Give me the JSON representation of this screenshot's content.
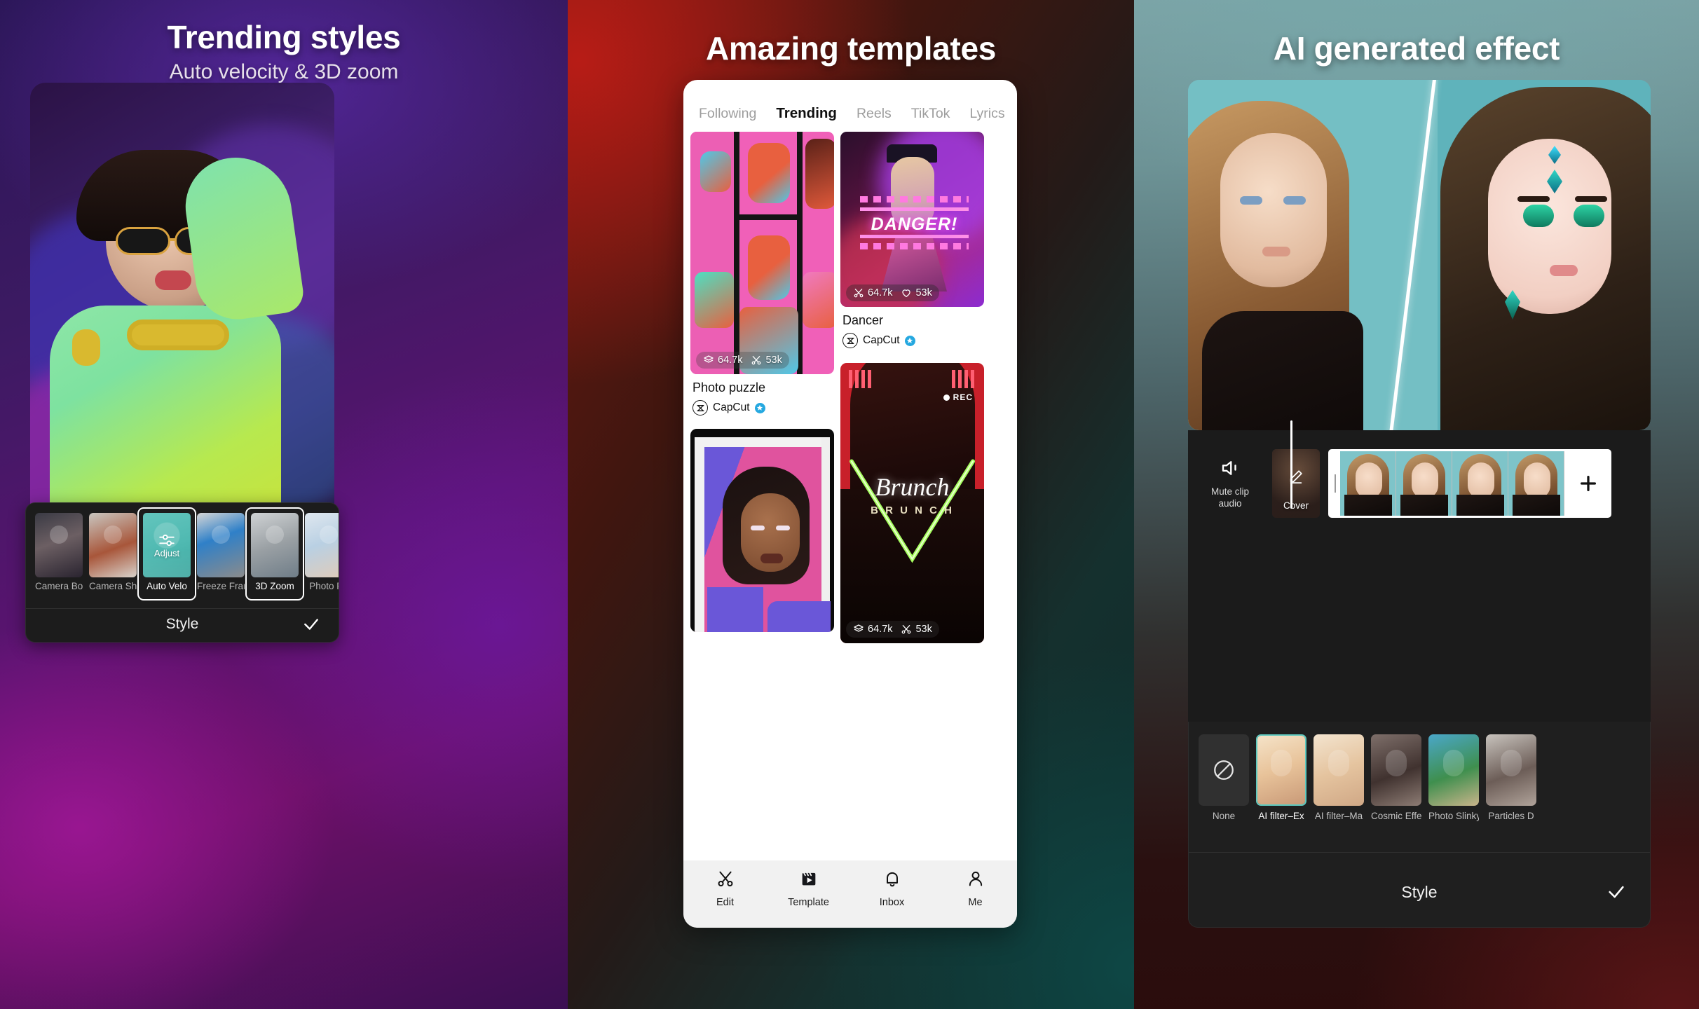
{
  "panels": [
    {
      "id": "trending-styles",
      "title": "Trending styles",
      "subtitle": "Auto velocity & 3D zoom",
      "bottom_bar": {
        "label": "Style",
        "confirm_icon": "check-icon"
      },
      "styles": [
        {
          "label": "Camera Bou",
          "selected": false,
          "kind": "photo"
        },
        {
          "label": "Camera Sha",
          "selected": false,
          "kind": "photo"
        },
        {
          "label": "Auto Velo",
          "selected": true,
          "kind": "adjust",
          "tile_label": "Adjust",
          "tile_color": "#4fb9b1"
        },
        {
          "label": "Freeze Fram",
          "selected": false,
          "kind": "photo"
        },
        {
          "label": "3D Zoom",
          "selected": true,
          "kind": "photo"
        },
        {
          "label": "Photo Pu",
          "selected": false,
          "kind": "photo"
        }
      ]
    },
    {
      "id": "amazing-templates",
      "title": "Amazing templates",
      "tabs": [
        {
          "label": "Following",
          "active": false
        },
        {
          "label": "Trending",
          "active": true
        },
        {
          "label": "Reels",
          "active": false
        },
        {
          "label": "TikTok",
          "active": false
        },
        {
          "label": "Lyrics",
          "active": false
        }
      ],
      "cards": [
        {
          "title": "Photo puzzle",
          "author": "CapCut",
          "verified": true,
          "stats": [
            {
              "icon": "use-icon",
              "value": "64.7k"
            },
            {
              "icon": "scissors-icon",
              "value": "53k"
            }
          ]
        },
        {
          "title": "Dancer",
          "author": "CapCut",
          "verified": true,
          "overlay_text": "DANGER!",
          "stats": [
            {
              "icon": "scissors-icon",
              "value": "64.7k"
            },
            {
              "icon": "heart-icon",
              "value": "53k"
            }
          ]
        },
        {
          "title": "",
          "author": "",
          "verified": false,
          "stats": []
        },
        {
          "title": "",
          "author": "",
          "verified": false,
          "overlay_text": "Brunch",
          "overlay_subtext": "B R U N C H",
          "badge": "REC",
          "stats": [
            {
              "icon": "use-icon",
              "value": "64.7k"
            },
            {
              "icon": "scissors-icon",
              "value": "53k"
            }
          ]
        }
      ],
      "nav": [
        {
          "label": "Edit",
          "icon": "scissors-icon",
          "active": false
        },
        {
          "label": "Template",
          "icon": "clapperboard-icon",
          "active": true
        },
        {
          "label": "Inbox",
          "icon": "bell-icon",
          "active": false
        },
        {
          "label": "Me",
          "icon": "person-icon",
          "active": false
        }
      ]
    },
    {
      "id": "ai-generated-effect",
      "title": "AI generated effect",
      "timeline": {
        "mute_label": "Mute clip\naudio",
        "mute_icon": "speaker-mute-icon",
        "cover_label": "Cover",
        "cover_icon": "pencil-icon",
        "add_label": "+",
        "frames": 4
      },
      "filters": [
        {
          "label": "None",
          "selected": false,
          "kind": "none"
        },
        {
          "label": "AI filter–Ex",
          "selected": true,
          "kind": "photo"
        },
        {
          "label": "AI filter–Ma",
          "selected": false,
          "kind": "photo"
        },
        {
          "label": "Cosmic Effe",
          "selected": false,
          "kind": "photo"
        },
        {
          "label": "Photo Slinky",
          "selected": false,
          "kind": "photo"
        },
        {
          "label": "Particles D",
          "selected": false,
          "kind": "photo"
        }
      ],
      "bottom_bar": {
        "label": "Style",
        "confirm_icon": "check-icon"
      }
    }
  ],
  "colors": {
    "accent_teal": "#4fb9b1",
    "verified_blue": "#25a8e0",
    "panel_dark": "#1c1c1c",
    "nav_light": "#f1f1f1"
  }
}
